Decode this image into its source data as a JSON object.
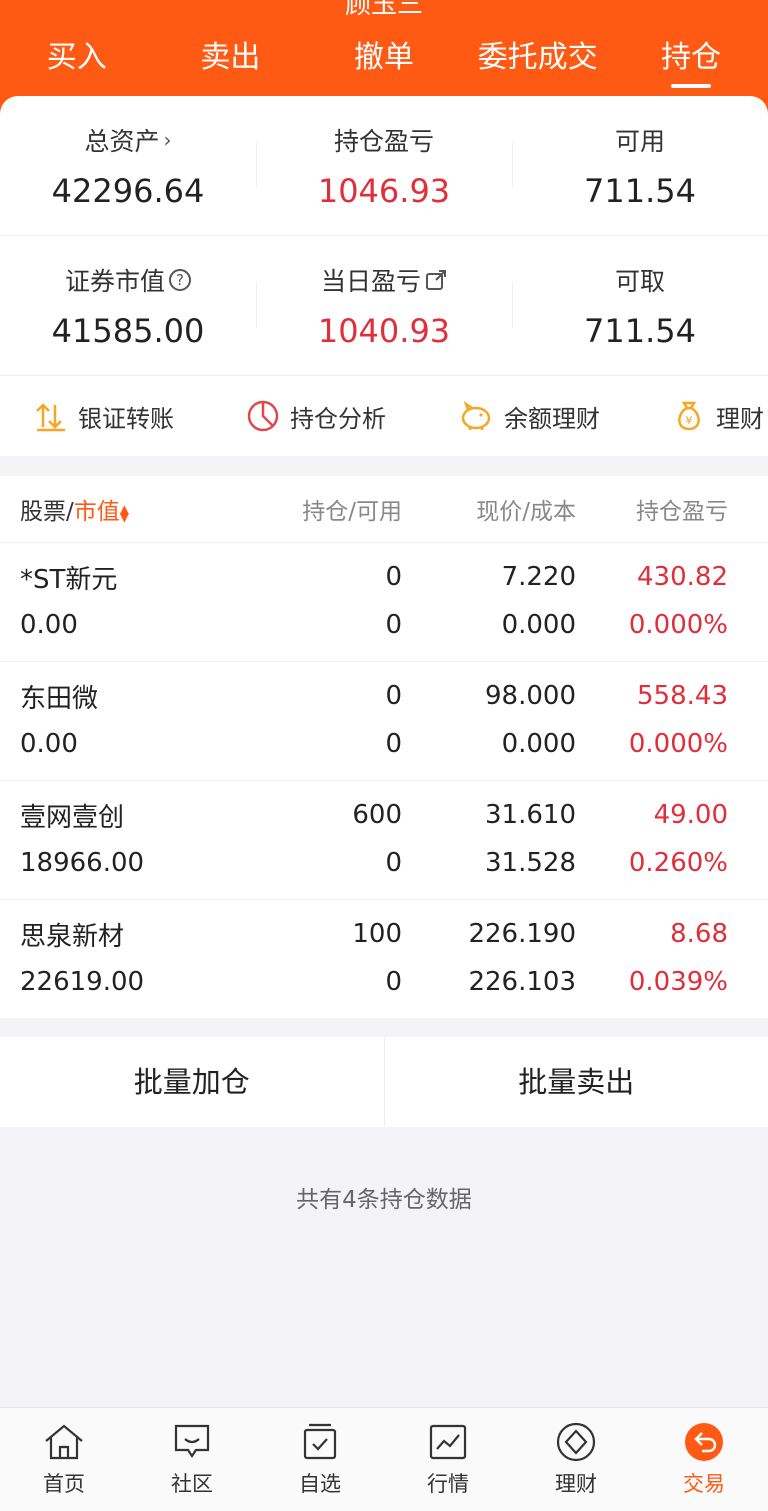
{
  "header": {
    "title": "顾玉三",
    "tabs": [
      {
        "label": "买入",
        "active": false
      },
      {
        "label": "卖出",
        "active": false
      },
      {
        "label": "撤单",
        "active": false
      },
      {
        "label": "委托成交",
        "active": false
      },
      {
        "label": "持仓",
        "active": true
      }
    ]
  },
  "summary": {
    "total_assets": {
      "label": "总资产",
      "value": "42296.64"
    },
    "position_pl": {
      "label": "持仓盈亏",
      "value": "1046.93"
    },
    "available": {
      "label": "可用",
      "value": "711.54"
    },
    "market_value": {
      "label": "证券市值",
      "value": "41585.00"
    },
    "daily_pl": {
      "label": "当日盈亏",
      "value": "1040.93"
    },
    "withdrawable": {
      "label": "可取",
      "value": "711.54"
    }
  },
  "quick_actions": [
    {
      "label": "银证转账",
      "icon": "transfer-icon"
    },
    {
      "label": "持仓分析",
      "icon": "pie-chart-icon"
    },
    {
      "label": "余额理财",
      "icon": "piggy-bank-icon"
    },
    {
      "label": "理财",
      "icon": "money-bag-icon"
    }
  ],
  "holdings": {
    "headers": {
      "stock": "股票/",
      "sort_field": "市值",
      "position": "持仓/可用",
      "price": "现价/成本",
      "pl": "持仓盈亏"
    },
    "rows": [
      {
        "name": "*ST新元",
        "market_value": "0.00",
        "position": "0",
        "available": "0",
        "price": "7.220",
        "cost": "0.000",
        "pl": "430.82",
        "pl_pct": "0.000%"
      },
      {
        "name": "东田微",
        "market_value": "0.00",
        "position": "0",
        "available": "0",
        "price": "98.000",
        "cost": "0.000",
        "pl": "558.43",
        "pl_pct": "0.000%"
      },
      {
        "name": "壹网壹创",
        "market_value": "18966.00",
        "position": "600",
        "available": "0",
        "price": "31.610",
        "cost": "31.528",
        "pl": "49.00",
        "pl_pct": "0.260%"
      },
      {
        "name": "思泉新材",
        "market_value": "22619.00",
        "position": "100",
        "available": "0",
        "price": "226.190",
        "cost": "226.103",
        "pl": "8.68",
        "pl_pct": "0.039%"
      }
    ]
  },
  "batch": {
    "add_label": "批量加仓",
    "sell_label": "批量卖出"
  },
  "footer_note": "共有4条持仓数据",
  "bottom_nav": [
    {
      "label": "首页",
      "icon": "home-icon",
      "active": false
    },
    {
      "label": "社区",
      "icon": "community-icon",
      "active": false
    },
    {
      "label": "自选",
      "icon": "watchlist-icon",
      "active": false
    },
    {
      "label": "行情",
      "icon": "market-icon",
      "active": false
    },
    {
      "label": "理财",
      "icon": "wealth-icon",
      "active": false
    },
    {
      "label": "交易",
      "icon": "trade-icon",
      "active": true
    }
  ],
  "colors": {
    "accent": "#ff5a14",
    "gain": "#e02e3a"
  }
}
